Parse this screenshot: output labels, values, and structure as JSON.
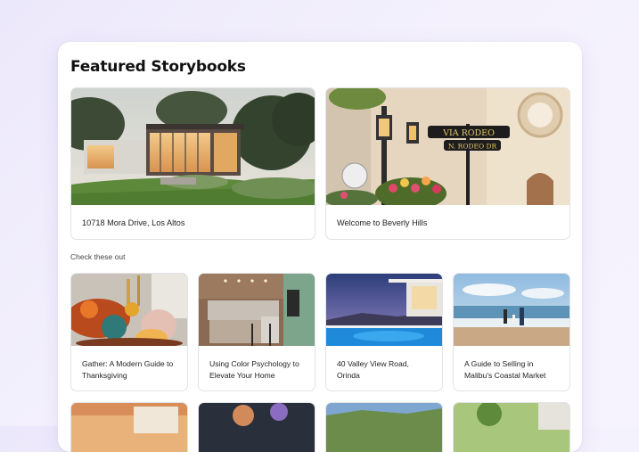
{
  "page": {
    "title": "Featured Storybooks"
  },
  "featured": [
    {
      "caption": "10718 Mora Drive, Los Altos",
      "image": "modern-house-photo"
    },
    {
      "caption": "Welcome to Beverly Hills",
      "image": "street-sign-photo"
    }
  ],
  "check_out": {
    "label": "Check these out",
    "items": [
      {
        "caption": "Gather: A Modern Guide to Thanksgiving",
        "image": "thanksgiving-table-photo"
      },
      {
        "caption": "Using Color Psychology to Elevate Your Home",
        "image": "kitchen-photo"
      },
      {
        "caption": "40 Valley View Road, Orinda",
        "image": "pool-dusk-photo"
      },
      {
        "caption": "A Guide to Selling in Malibu's Coastal Market",
        "image": "beach-family-photo"
      }
    ]
  },
  "sign_text": {
    "line1": "VIA RODEO",
    "line2": "N. RODEO DR"
  }
}
